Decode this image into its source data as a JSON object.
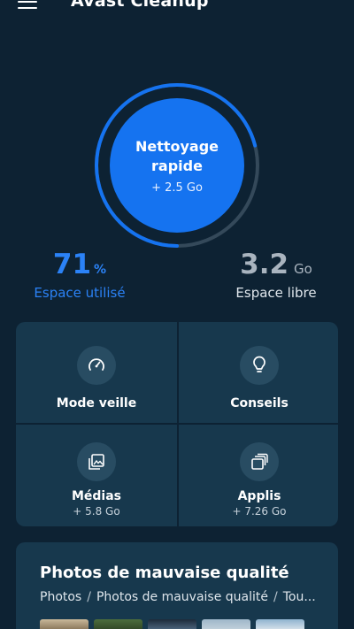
{
  "header": {
    "title": "Avast Cleanup"
  },
  "quick_clean": {
    "title": "Nettoyage rapide",
    "subtitle": "+ 2.5 Go"
  },
  "storage": {
    "used_value": "71",
    "used_unit": "%",
    "used_label": "Espace utilisé",
    "used_fraction": 0.71,
    "free_value": "3.2",
    "free_unit": "Go",
    "free_label": "Espace libre"
  },
  "tiles": [
    {
      "label": "Mode veille",
      "sub": "",
      "icon": "speedometer-icon"
    },
    {
      "label": "Conseils",
      "sub": "",
      "icon": "lightbulb-icon"
    },
    {
      "label": "Médias",
      "sub": "+ 5.8 Go",
      "icon": "media-gallery-icon"
    },
    {
      "label": "Applis",
      "sub": "+ 7.26 Go",
      "icon": "apps-stack-icon"
    }
  ],
  "photos_card": {
    "title": "Photos de mauvaise qualité",
    "breadcrumb": [
      "Photos",
      "Photos de mauvaise qualité",
      "Tou..."
    ]
  },
  "colors": {
    "background": "#0d2233",
    "card": "#17384d",
    "accent": "#1573f0",
    "accent_text": "#2b82f6",
    "ring_track": "#34495a"
  }
}
